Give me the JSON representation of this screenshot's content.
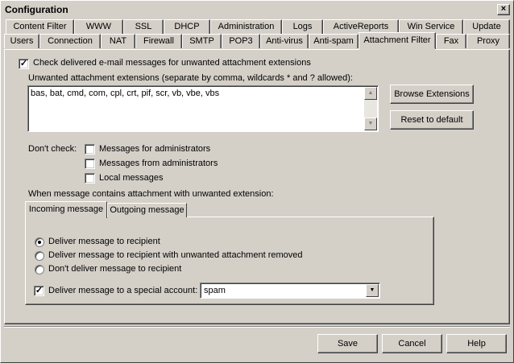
{
  "window": {
    "title": "Configuration",
    "close_label": "×"
  },
  "tabs_row1": [
    "Content Filter",
    "WWW",
    "SSL",
    "DHCP",
    "Administration",
    "Logs",
    "ActiveReports",
    "Win Service",
    "Update"
  ],
  "tabs_row2": [
    "Users",
    "Connection",
    "NAT",
    "Firewall",
    "SMTP",
    "POP3",
    "Anti-virus",
    "Anti-spam",
    "Attachment Filter",
    "Fax",
    "Proxy"
  ],
  "active_tab": "Attachment Filter",
  "check_enable": {
    "label": "Check delivered e-mail messages for unwanted attachment extensions",
    "checked": true,
    "mark": "✓"
  },
  "extensions": {
    "label": "Unwanted attachment extensions (separate by comma, wildcards * and ? allowed):",
    "value": "bas, bat, cmd, com, cpl, crt, pif, scr, vb, vbe, vbs"
  },
  "buttons": {
    "browse": "Browse Extensions",
    "reset": "Reset to default"
  },
  "dont_check": {
    "label": "Don't check:",
    "options": [
      "Messages for administrators",
      "Messages from administrators",
      "Local messages"
    ]
  },
  "action_label": "When message contains attachment with unwanted extension:",
  "inner_tabs": [
    "Incoming message",
    "Outgoing message"
  ],
  "delivery": {
    "options": [
      "Deliver message to recipient",
      "Deliver message to recipient with unwanted attachment removed",
      "Don't deliver message to recipient"
    ],
    "selected": 0
  },
  "special_account": {
    "label": "Deliver message to a special account:",
    "checked": true,
    "mark": "✓",
    "value": "spam"
  },
  "footer": {
    "save": "Save",
    "cancel": "Cancel",
    "help": "Help"
  }
}
